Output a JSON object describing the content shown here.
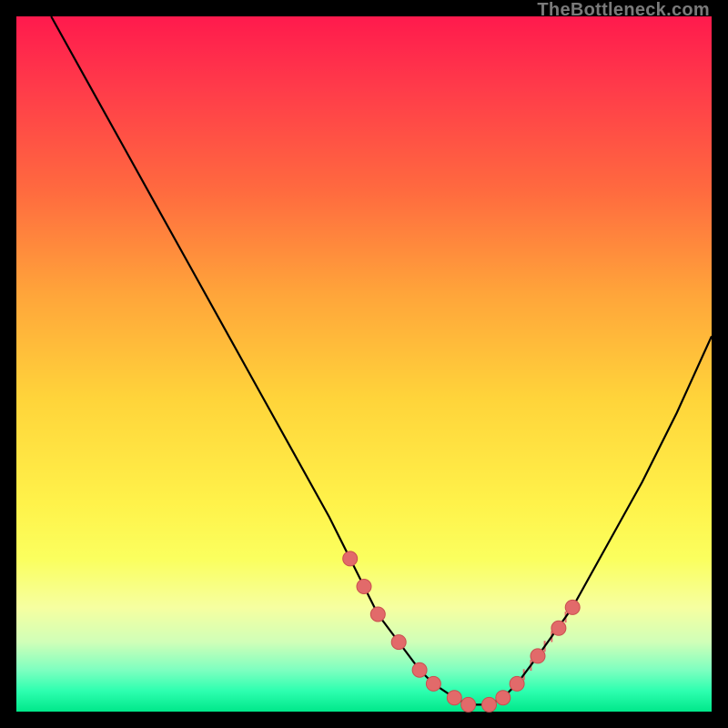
{
  "watermark": "TheBottleneck.com",
  "chart_data": {
    "type": "line",
    "title": "",
    "xlabel": "",
    "ylabel": "",
    "xlim": [
      0,
      100
    ],
    "ylim": [
      0,
      100
    ],
    "series": [
      {
        "name": "curve",
        "x": [
          5,
          10,
          15,
          20,
          25,
          30,
          35,
          40,
          45,
          48,
          50,
          52,
          55,
          58,
          60,
          63,
          65,
          68,
          70,
          72,
          75,
          80,
          85,
          90,
          95,
          100
        ],
        "y": [
          100,
          91,
          82,
          73,
          64,
          55,
          46,
          37,
          28,
          22,
          18,
          14,
          10,
          6,
          4,
          2,
          1,
          1,
          2,
          4,
          8,
          15,
          24,
          33,
          43,
          54
        ]
      }
    ],
    "annotations": {
      "dots": [
        {
          "x": 48,
          "y": 22
        },
        {
          "x": 50,
          "y": 18
        },
        {
          "x": 52,
          "y": 14
        },
        {
          "x": 55,
          "y": 10
        },
        {
          "x": 58,
          "y": 6
        },
        {
          "x": 60,
          "y": 4
        },
        {
          "x": 63,
          "y": 2
        },
        {
          "x": 65,
          "y": 1
        },
        {
          "x": 68,
          "y": 1
        },
        {
          "x": 70,
          "y": 2
        },
        {
          "x": 72,
          "y": 4
        },
        {
          "x": 75,
          "y": 8
        },
        {
          "x": 78,
          "y": 12
        },
        {
          "x": 80,
          "y": 15
        }
      ],
      "ticks_x": [
        73,
        74,
        75,
        76,
        77,
        78,
        79
      ]
    }
  }
}
